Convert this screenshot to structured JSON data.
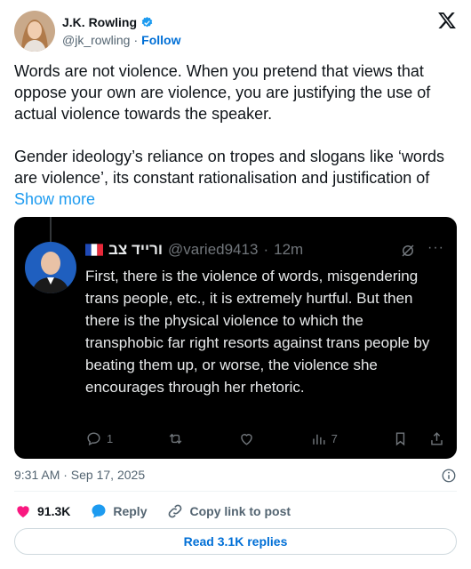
{
  "author": {
    "name": "J.K. Rowling",
    "handle": "@jk_rowling",
    "separator": "·",
    "follow_label": "Follow"
  },
  "tweet": {
    "text": "Words are not violence. When you pretend that views that oppose your own are violence, you are justifying the use of actual violence towards the speaker.\n\nGender ideology’s reliance on tropes and slogans like ‘words are violence’, its constant rationalisation and justification of ",
    "show_more": "Show more"
  },
  "embed": {
    "name": "ורייד צב",
    "handle": "@varied9413",
    "separator": "·",
    "time": "12m",
    "more": "···",
    "text": "First, there is the violence of words, misgendering trans people, etc., it is extremely hurtful. But then there is the physical violence to which the transphobic far right resorts against trans people by beating them up, or worse, the violence she encourages through her rhetoric.",
    "reply_count": "1",
    "views_count": "7"
  },
  "meta": {
    "timestamp": "9:31 AM · Sep 17, 2025"
  },
  "footer": {
    "likes": "91.3K",
    "reply_label": "Reply",
    "copy_label": "Copy link to post",
    "read_replies": "Read 3.1K replies"
  },
  "colors": {
    "like": "#f91880",
    "reply": "#1d9bf0",
    "link": "#006fd6",
    "verified": "#1d9bf0"
  }
}
